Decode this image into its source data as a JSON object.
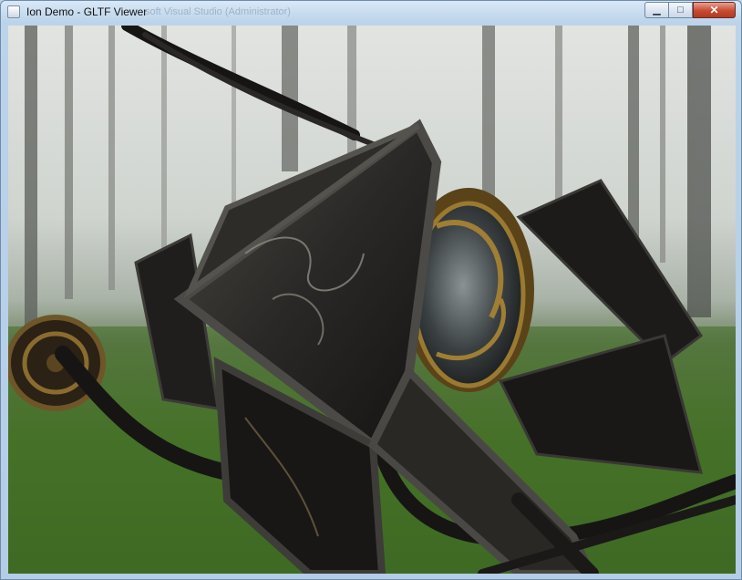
{
  "window": {
    "title": "Ion Demo - GLTF Viewer",
    "ghost_title": "soft Visual Studio (Administrator)",
    "controls": {
      "minimize": "▁",
      "maximize": "□",
      "close": "✕"
    }
  },
  "colors": {
    "frame": "#bcd3ea",
    "close_button": "#c74a32",
    "scene_fog": "#d8dcd8",
    "scene_grass": "#4d7a2a",
    "model_dark": "#1d1c1a",
    "model_brass": "#9a7a30"
  },
  "viewport": {
    "content": "3D rendered steampunk lantern model over misty forest background"
  }
}
